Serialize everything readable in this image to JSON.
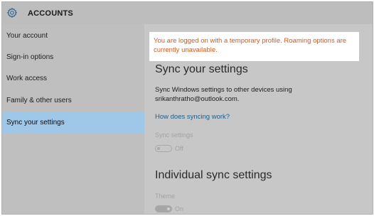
{
  "header": {
    "title": "ACCOUNTS",
    "icon": "gear-icon"
  },
  "sidebar": {
    "items": [
      {
        "label": "Your account",
        "active": false
      },
      {
        "label": "Sign-in options",
        "active": false
      },
      {
        "label": "Work access",
        "active": false
      },
      {
        "label": "Family & other users",
        "active": false
      },
      {
        "label": "Sync your settings",
        "active": true
      }
    ]
  },
  "main": {
    "notice": "You are logged on with a temporary profile. Roaming options are currently unavailable.",
    "heading": "Sync your settings",
    "description": "Sync Windows settings to other devices using srikanthratho@outlook.com.",
    "link": "How does syncing work?",
    "sync_settings": {
      "label": "Sync settings",
      "state": "Off",
      "on": false
    },
    "individual_heading": "Individual sync settings",
    "theme": {
      "label": "Theme",
      "state": "On",
      "on": true
    }
  },
  "colors": {
    "notice_text": "#d65a1c",
    "active_nav": "#9fc7e8",
    "link": "#1c5f8d"
  }
}
